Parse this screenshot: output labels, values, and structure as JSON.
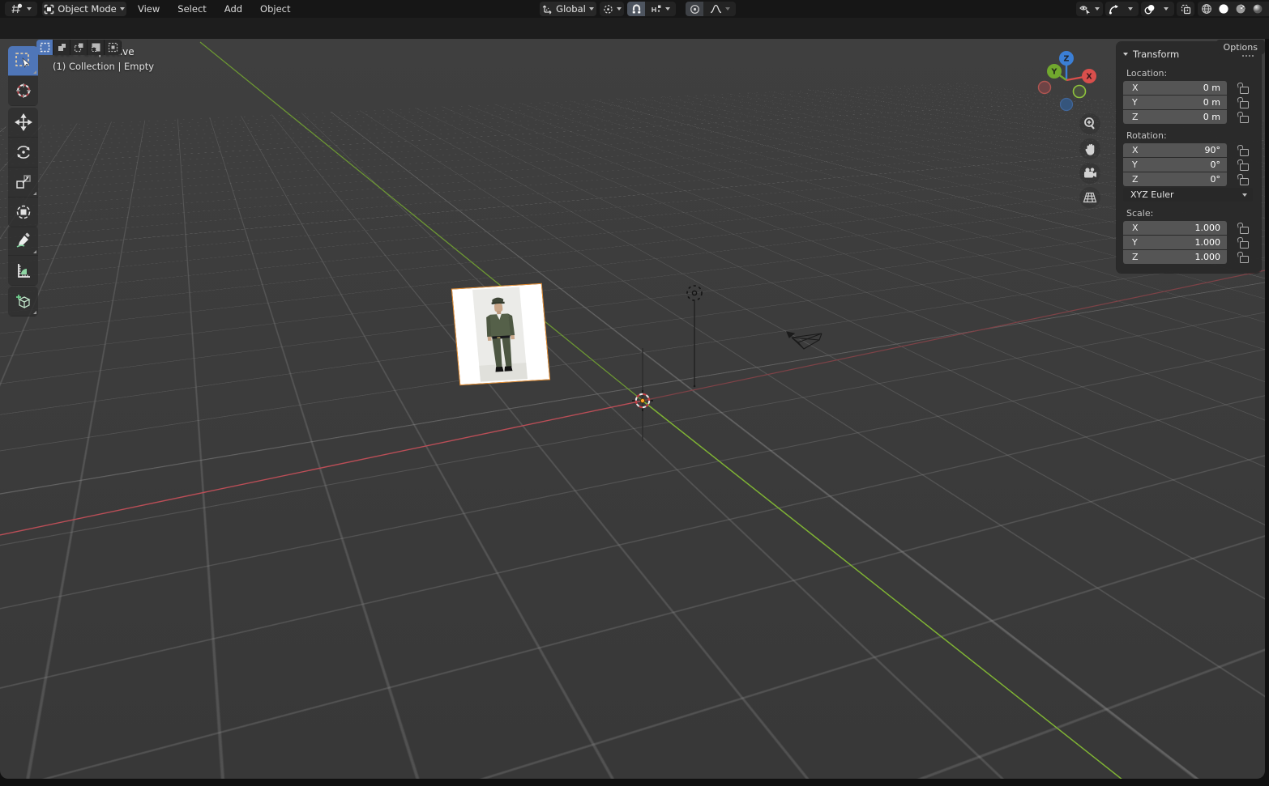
{
  "topbar": {
    "editor_selector": {
      "icon": "viewport-editor-icon"
    },
    "mode": {
      "label": "Object Mode",
      "icon": "object-mode-icon"
    },
    "menus": [
      {
        "label": "View"
      },
      {
        "label": "Select"
      },
      {
        "label": "Add"
      },
      {
        "label": "Object"
      }
    ],
    "orientation": {
      "label": "Global",
      "icon": "transform-orientation-icon"
    },
    "pivot": {
      "icon": "pivot-point-icon"
    },
    "snap": {
      "magnet_icon": "magnet-icon",
      "target_icon": "snap-increment-icon"
    },
    "proportional": {
      "toggle_icon": "proportional-edit-icon",
      "falloff_icon": "falloff-curve-icon"
    },
    "display": {
      "visibility_icon": "object-visibility-icon",
      "gizmos_icon": "show-gizmos-icon",
      "overlays_icon": "show-overlays-icon",
      "xray_icon": "toggle-xray-icon"
    },
    "shading": {
      "modes": [
        "wireframe",
        "solid",
        "material-preview",
        "rendered"
      ],
      "active": "solid"
    }
  },
  "tool_settings": {
    "select_modes": [
      "set",
      "extend",
      "subtract",
      "invert",
      "intersect"
    ],
    "active_mode": "set",
    "options_label": "Options"
  },
  "toolbar": {
    "tools": [
      "select-box",
      "cursor",
      "move",
      "rotate",
      "scale",
      "transform",
      "annotate",
      "measure",
      "add-cube"
    ],
    "active_tool": "select-box"
  },
  "viewport": {
    "perspective_label": "User Perspective",
    "context_label": "(1) Collection | Empty",
    "gizmo": {
      "x": "X",
      "y": "Y",
      "z": "Z"
    },
    "colors": {
      "x_axis_near": "#bb4e57",
      "x_axis_far": "#7e4247",
      "y_axis_near": "#7fb334",
      "y_axis_far": "#6c9733",
      "selection_outline": "#e8933a",
      "background": "#3b3b3b",
      "active_tool_blue": "#4f76b8"
    }
  },
  "transform_panel": {
    "title": "Transform",
    "location": {
      "label": "Location:",
      "rows": [
        {
          "axis": "X",
          "value": "0 m"
        },
        {
          "axis": "Y",
          "value": "0 m"
        },
        {
          "axis": "Z",
          "value": "0 m"
        }
      ]
    },
    "rotation": {
      "label": "Rotation:",
      "rows": [
        {
          "axis": "X",
          "value": "90°"
        },
        {
          "axis": "Y",
          "value": "0°"
        },
        {
          "axis": "Z",
          "value": "0°"
        }
      ],
      "mode": "XYZ Euler"
    },
    "scale": {
      "label": "Scale:",
      "rows": [
        {
          "axis": "X",
          "value": "1.000"
        },
        {
          "axis": "Y",
          "value": "1.000"
        },
        {
          "axis": "Z",
          "value": "1.000"
        }
      ]
    }
  }
}
